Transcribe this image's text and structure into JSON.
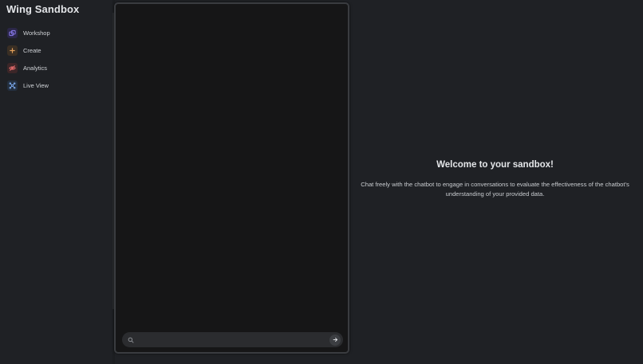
{
  "app": {
    "title": "Wing Sandbox"
  },
  "sidebar": {
    "items": [
      {
        "label": "Workshop",
        "icon": "workshop-icon",
        "color": "#8b7bf0",
        "bg": "#2b2748"
      },
      {
        "label": "Create",
        "icon": "plus-icon",
        "color": "#e2a05a",
        "bg": "#3a2f24"
      },
      {
        "label": "Analytics",
        "icon": "eye-icon",
        "color": "#e06a6a",
        "bg": "#3c2628"
      },
      {
        "label": "Live View",
        "icon": "network-icon",
        "color": "#7aa6e8",
        "bg": "#243040"
      }
    ]
  },
  "chat": {
    "input_value": "",
    "input_placeholder": ""
  },
  "welcome": {
    "title": "Welcome to your sandbox!",
    "body": "Chat freely with the chatbot to engage in conversations to evaluate the effectiveness of the chatbot's understanding of your provided data."
  }
}
